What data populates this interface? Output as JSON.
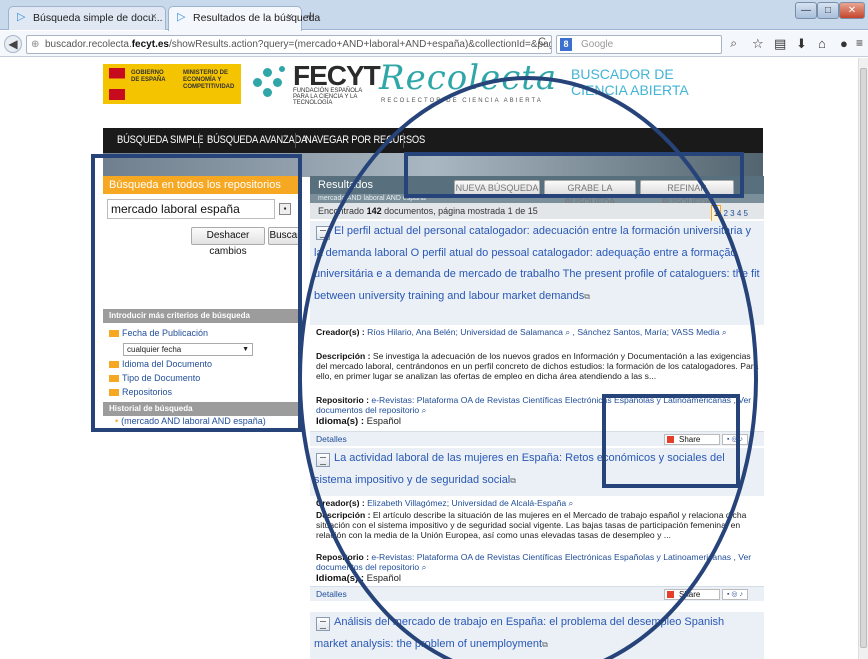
{
  "browser": {
    "tabs": [
      {
        "label": "Búsqueda simple de docu...",
        "close": "×"
      },
      {
        "label": "Resultados de la búsqueda",
        "close": "×"
      }
    ],
    "new_tab": "+",
    "window_controls": {
      "minimize": "—",
      "maximize": "□",
      "close": "✕"
    },
    "url_prefix": "buscador.recolecta.",
    "url_domain": "fecyt.es",
    "url_rest": "/showResults.action?query=(mercado+AND+laboral+AND+españa)&collectionId=&page=1&size=10&for",
    "search_engine_label": "8",
    "search_placeholder": "Google",
    "toolbar_icons": [
      "search-icon",
      "star-icon",
      "clipboard-icon",
      "download-icon",
      "home-icon",
      "chat-icon",
      "menu-icon"
    ]
  },
  "header": {
    "gov_text": "GOBIERNO DE ESPAÑA",
    "ministry_text": "MINISTERIO DE ECONOMÍA Y COMPETITIVIDAD",
    "fecyt": "FECYT",
    "fecyt_sub": "FUNDACIÓN ESPAÑOLA PARA LA CIENCIA Y LA TECNOLOGÍA",
    "recolecta": "Recolecta",
    "recolecta_sub": "RECOLECTOR DE CIENCIA ABIERTA",
    "buscador_line1": "BUSCADOR DE",
    "buscador_line2": "CIENCIA ABIERTA"
  },
  "menu": {
    "simple": "BÚSQUEDA SIMPLE",
    "advanced": "BÚSQUEDA AVANZADA",
    "browse": "NAVEGAR POR RECURSOS"
  },
  "left_panel": {
    "title": "Búsqueda en todos los repositorios",
    "query": "mercado laboral españa",
    "undo_button": "Deshacer cambios",
    "search_button": "Buscar",
    "criteria_title": "Introducir más criterios de búsqueda",
    "criteria": [
      "Fecha de Publicación",
      "Idioma del Documento",
      "Tipo de Documento",
      "Repositorios"
    ],
    "date_select": "cualquier fecha",
    "history_title": "Historial de búsqueda",
    "history_item": "(mercado AND laboral AND españa)"
  },
  "results": {
    "title": "Resultados",
    "crumb": "mercado AND laboral AND españa",
    "new_search": "NUEVA BÚSQUEDA",
    "save_search": "GRABE LA BÚSQUEDA",
    "refine_search": "REFINAR BÚSQUEDA",
    "count_prefix": "Encontrado",
    "count": "142",
    "count_suffix": "documentos, página mostrada 1 de 15",
    "pages": [
      "1",
      "2",
      "3",
      "4",
      "5"
    ],
    "labels": {
      "creators": "Creador(s) :",
      "description": "Descripción :",
      "repository": "Repositorio :",
      "language": "Idioma(s) :",
      "details": "Detalles",
      "share": "Share"
    },
    "items": [
      {
        "title": "El perfil actual del personal catalogador: adecuación entre la formación universitaria y la demanda laboral O perfil atual do pessoal catalogador: adequação entre a formação universitária e a demanda de mercado de trabalho The present profile of cataloguers: the fit between university training and labour market demands",
        "creators": "Ríos Hilario, Ana Belén; Universidad de Salamanca ⌕ , Sánchez Santos, María; VASS Media ⌕",
        "description": "Se investiga la adecuación de los nuevos grados en Información y Documentación a las exigencias del mercado laboral, centrándonos en un perfil concreto de dichos estudios: la formación de los catalogadores. Para ello, en primer lugar se analizan las ofertas de empleo en dicha área atendiendo a las s...",
        "repository": "e-Revistas: Plataforma OA de Revistas Científicas Electrónicas Españolas y Latinoamericanas , Ver documentos del repositorio ⌕",
        "language": "Español"
      },
      {
        "title": "La actividad laboral de las mujeres en España: Retos económicos y sociales del sistema impositivo y de seguridad social",
        "creators": "Elizabeth Villagómez; Universidad de Alcalá-España ⌕",
        "description": "El artículo describe la situación de las mujeres en el Mercado de trabajo español y relaciona dicha situación con el sistema impositivo y de seguridad social vigente. Las bajas tasas de participación femenina, en relación con la media de la Unión Europea, así como unas elevadas tasas de desempleo y ...",
        "repository": "e-Revistas: Plataforma OA de Revistas Científicas Electrónicas Españolas y Latinoamericanas , Ver documentos del repositorio ⌕",
        "language": "Español"
      },
      {
        "title": "Análisis del mercado de trabajo en España: el problema del desempleo Spanish market analysis: the problem of unemployment"
      }
    ]
  }
}
